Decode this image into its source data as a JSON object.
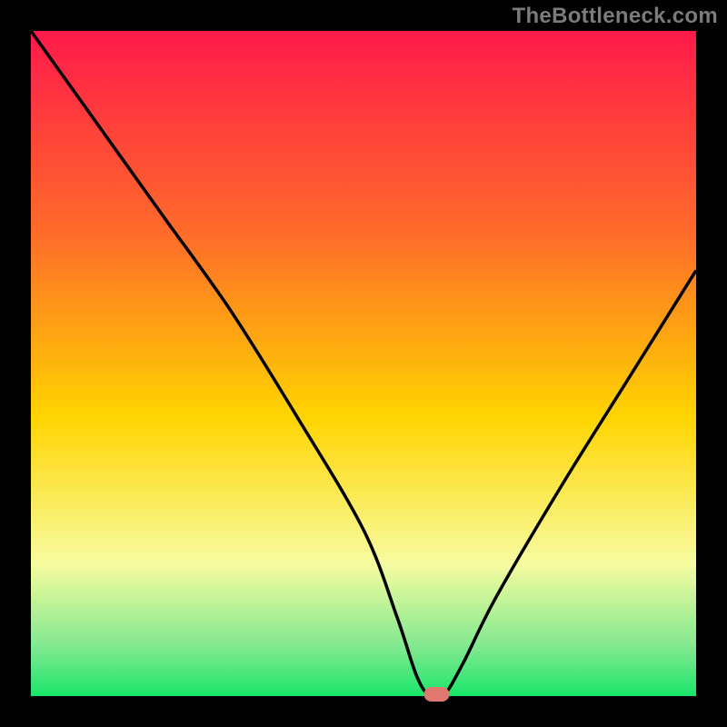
{
  "branding": "TheBottleneck.com",
  "chart_data": {
    "type": "line",
    "title": "",
    "xlabel": "",
    "ylabel": "",
    "xlim": [
      0,
      100
    ],
    "ylim": [
      0,
      100
    ],
    "series": [
      {
        "name": "bottleneck-curve",
        "x": [
          0,
          10,
          20,
          30,
          40,
          50,
          55,
          58,
          60,
          62,
          65,
          70,
          80,
          90,
          100
        ],
        "y": [
          100,
          86,
          72,
          58,
          42,
          25,
          12,
          3,
          0,
          0,
          5,
          15,
          32,
          48,
          64
        ]
      }
    ],
    "marker": {
      "x": 61,
      "y": 0
    },
    "gradient_colors": {
      "top": "#ff1a4b",
      "upper": "#ff6a2a",
      "mid": "#ffd400",
      "lower": "#f8fca0",
      "green1": "#7de88f",
      "green2": "#19e66a"
    },
    "marker_color": "#e2776f",
    "curve_color": "#000000"
  }
}
